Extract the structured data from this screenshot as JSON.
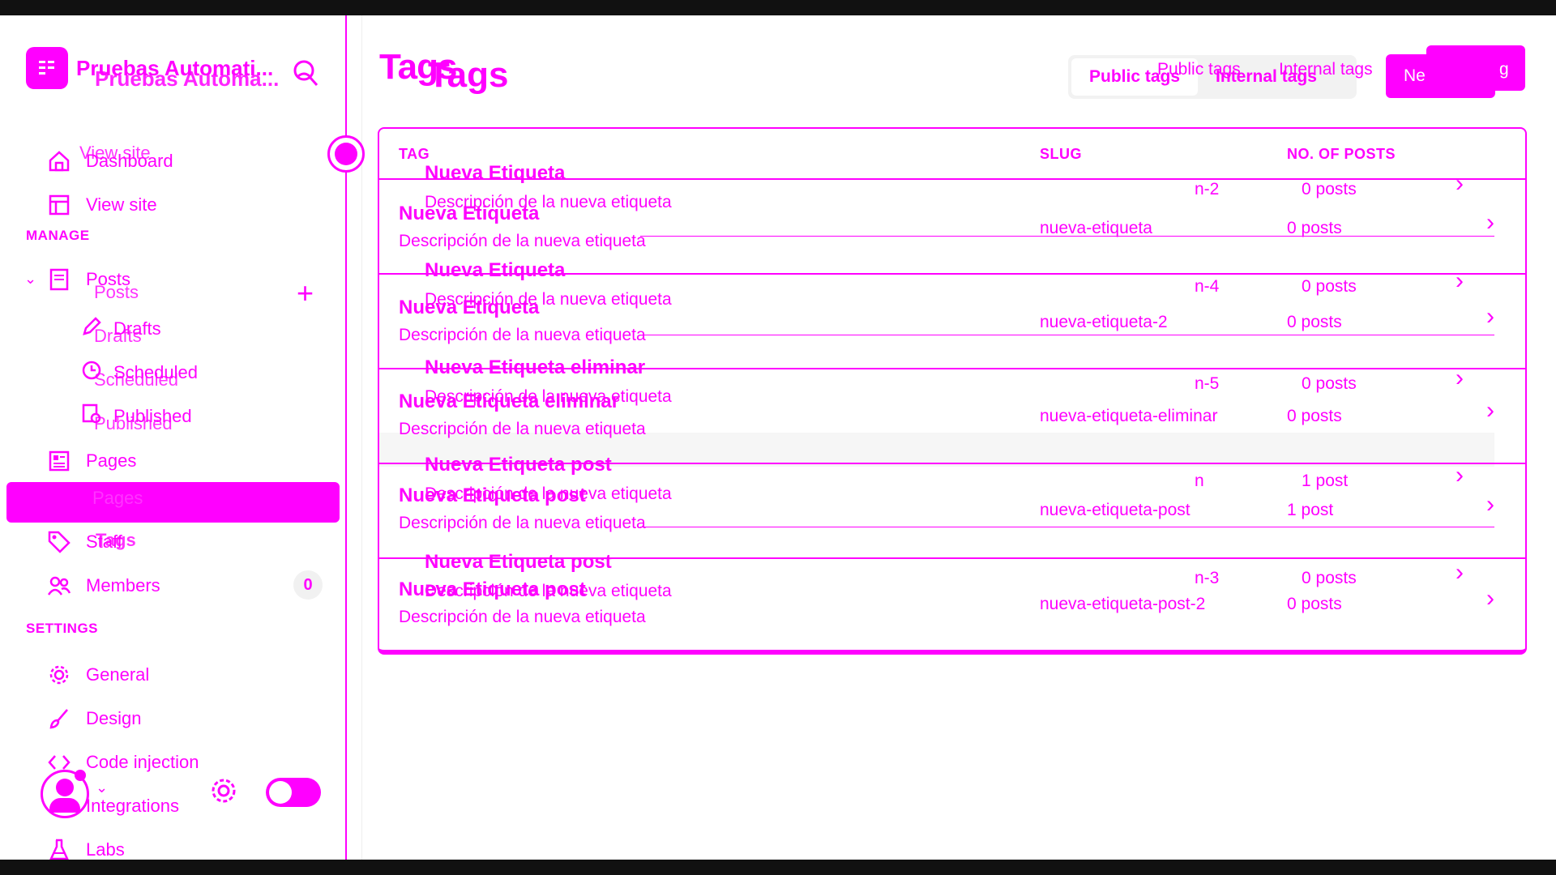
{
  "sidebar": {
    "site_title": "Pruebas Automati...",
    "site_title_ghost": "Pruebas Automa...",
    "nav": {
      "view_site_ghost": "View site",
      "dashboard": "Dashboard",
      "view_site": "View site",
      "manage_label": "MANAGE",
      "posts": "Posts",
      "posts_ghost": "Posts",
      "drafts": "Drafts",
      "drafts_ghost": "Drafts",
      "scheduled": "Scheduled",
      "scheduled_ghost": "Scheduled",
      "published": "Published",
      "published_ghost": "Published",
      "pages": "Pages",
      "pages_ghost": "Pages",
      "tags": "Tags",
      "staff": "Staff",
      "members": "Members",
      "members_count": "0",
      "settings_label": "SETTINGS",
      "general": "General",
      "design": "Design",
      "code_injection": "Code injection",
      "integrations": "Integrations",
      "labs": "Labs"
    }
  },
  "main": {
    "title": "Tags",
    "title_ghost": "Tags",
    "tabs": {
      "public": "Public tags",
      "internal": "Internal tags",
      "public_ghost": "Public tags",
      "internal_ghost": "Internal tags"
    },
    "new_tag_label": "Ne",
    "new_tag_ghost": "g",
    "table": {
      "headers": {
        "tag": "TAG",
        "slug": "SLUG",
        "posts": "NO. OF POSTS"
      },
      "rows": [
        {
          "name": "Nueva Etiqueta",
          "desc": "Descripción de la nueva etiqueta",
          "slug": "nueva-etiqueta",
          "posts": "0 posts",
          "ghost_name": "Nueva Etiqueta",
          "ghost_desc": "Descripción de la nueva etiqueta",
          "ghost_slug": "n-2",
          "ghost_posts": "0 posts"
        },
        {
          "name": "Nueva Etiqueta",
          "desc": "Descripción de la nueva etiqueta",
          "slug": "nueva-etiqueta-2",
          "posts": "0 posts",
          "ghost_name": "Nueva Etiqueta",
          "ghost_desc": "Descripción de la nueva etiqueta",
          "ghost_slug": "n-4",
          "ghost_posts": "0 posts"
        },
        {
          "name": "Nueva Etiqueta eliminar",
          "desc": "Descripción de la nueva etiqueta",
          "slug": "nueva-etiqueta-eliminar",
          "posts": "0 posts",
          "ghost_name": "Nueva Etiqueta eliminar",
          "ghost_desc": "Descripción de la nueva etiqueta",
          "ghost_slug": "n-5",
          "ghost_posts": "0 posts"
        },
        {
          "name": "Nueva Etiqueta post",
          "desc": "Descripción de la nueva etiqueta",
          "slug": "nueva-etiqueta-post",
          "posts": "1 post",
          "ghost_name": "Nueva Etiqueta post",
          "ghost_desc": "Descripción de la nueva etiqueta",
          "ghost_slug": "n",
          "ghost_posts": "1 post"
        },
        {
          "name": "Nueva Etiqueta post",
          "desc": "Descripción de la nueva etiqueta",
          "slug": "nueva-etiqueta-post-2",
          "posts": "0 posts",
          "ghost_name": "Nueva Etiqueta post",
          "ghost_desc": "Descripción de la nueva etiqueta",
          "ghost_slug": "n-3",
          "ghost_posts": "0 posts"
        }
      ]
    }
  },
  "colors": {
    "accent": "#ff00ff",
    "frame": "#111111"
  }
}
